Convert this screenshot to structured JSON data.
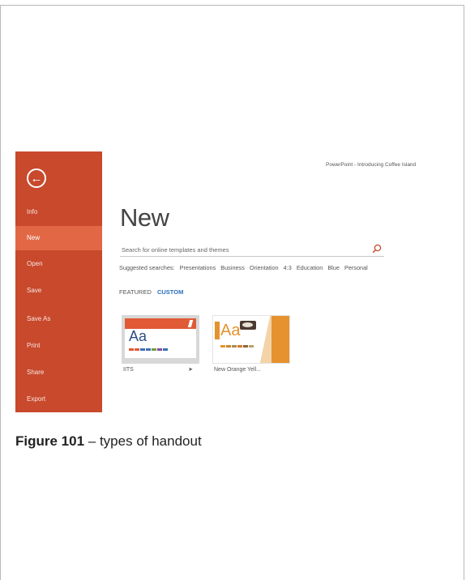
{
  "app": {
    "title": "PowerPoint - Introducing Coffee Island"
  },
  "backstage": {
    "back_icon": "back-arrow-icon",
    "nav_items": [
      {
        "label": "Info",
        "active": false
      },
      {
        "label": "New",
        "active": true
      },
      {
        "label": "Open",
        "active": false
      },
      {
        "label": "Save",
        "active": false
      },
      {
        "label": "Save As",
        "active": false
      },
      {
        "label": "Print",
        "active": false
      },
      {
        "label": "Share",
        "active": false
      },
      {
        "label": "Export",
        "active": false
      }
    ]
  },
  "main": {
    "heading": "New",
    "search": {
      "placeholder": "Search for online templates and themes",
      "icon": "search-icon"
    },
    "suggested": {
      "label": "Suggested searches:",
      "items": [
        "Presentations",
        "Business",
        "Orientation",
        "4:3",
        "Education",
        "Blue",
        "Personal"
      ]
    },
    "tabs": {
      "featured": "FEATURED",
      "custom": "CUSTOM"
    },
    "templates": [
      {
        "name": "IITS",
        "thumb_text": "Aa",
        "pin_icon": "pin-icon"
      },
      {
        "name": "New Orange Yell...",
        "thumb_text": "Aa"
      }
    ]
  },
  "caption": {
    "figure": "Figure 101",
    "text": "– types of handout"
  },
  "colors": {
    "backstage": "#c8492c",
    "backstage_active": "#e26845",
    "accent_blue": "#2b6ebc"
  }
}
